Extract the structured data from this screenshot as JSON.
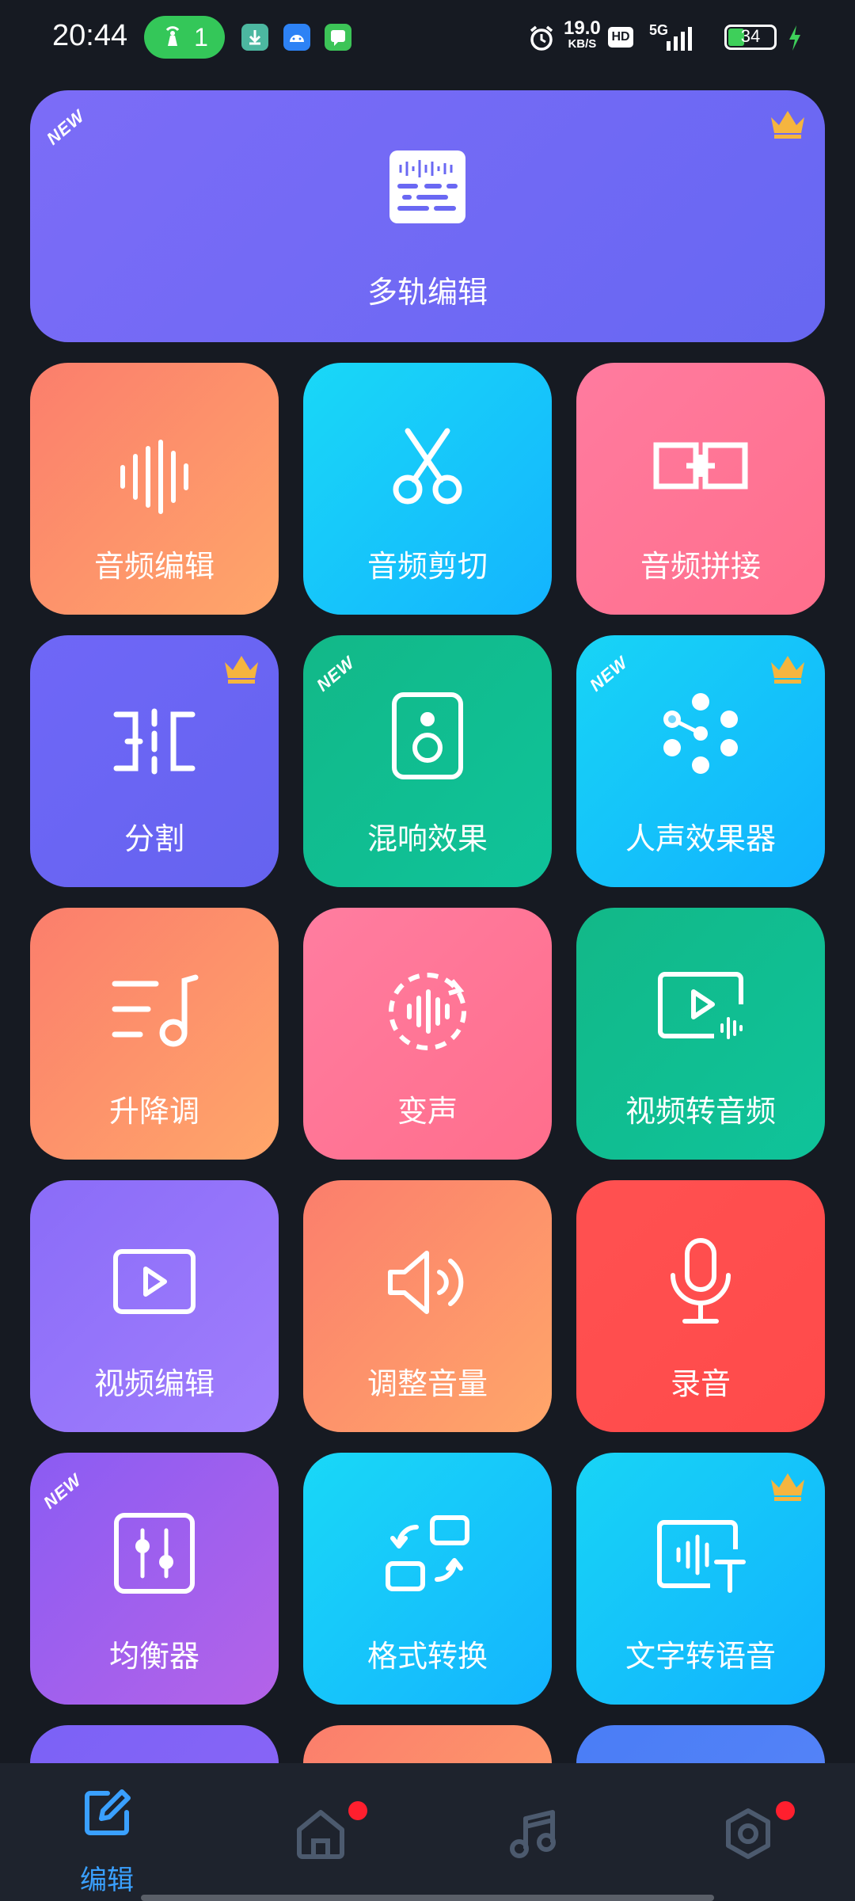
{
  "status_bar": {
    "time": "20:44",
    "hotspot_count": "1",
    "speed_value": "19.0",
    "speed_unit": "KB/S",
    "hd": "HD",
    "network": "5G",
    "battery": "34",
    "battery_level": 0.34
  },
  "featured": {
    "label": "多轨编辑",
    "new_badge": "NEW",
    "premium": true
  },
  "tools": [
    {
      "label": "音频编辑",
      "icon": "waveform-icon"
    },
    {
      "label": "音频剪切",
      "icon": "scissors-icon"
    },
    {
      "label": "音频拼接",
      "icon": "merge-icon"
    },
    {
      "label": "分割",
      "icon": "split-icon",
      "premium": true
    },
    {
      "label": "混响效果",
      "icon": "speaker-icon",
      "new_badge": "NEW"
    },
    {
      "label": "人声效果器",
      "icon": "dots-effect-icon",
      "new_badge": "NEW",
      "premium": true
    },
    {
      "label": "升降调",
      "icon": "pitch-icon"
    },
    {
      "label": "变声",
      "icon": "voice-change-icon"
    },
    {
      "label": "视频转音频",
      "icon": "video-to-audio-icon"
    },
    {
      "label": "视频编辑",
      "icon": "video-edit-icon"
    },
    {
      "label": "调整音量",
      "icon": "volume-icon"
    },
    {
      "label": "录音",
      "icon": "microphone-icon"
    },
    {
      "label": "均衡器",
      "icon": "equalizer-icon",
      "new_badge": "NEW"
    },
    {
      "label": "格式转换",
      "icon": "format-convert-icon"
    },
    {
      "label": "文字转语音",
      "icon": "text-to-speech-icon",
      "premium": true
    }
  ],
  "bottom_nav": {
    "items": [
      {
        "label": "编辑",
        "icon": "edit-icon",
        "active": true
      },
      {
        "label": "",
        "icon": "home-icon",
        "badge": true
      },
      {
        "label": "",
        "icon": "music-icon"
      },
      {
        "label": "",
        "icon": "settings-icon",
        "badge": true
      }
    ]
  },
  "colors": {
    "background": "#161a22",
    "accent": "#3aa0ff",
    "crown": "#f5b53f"
  }
}
